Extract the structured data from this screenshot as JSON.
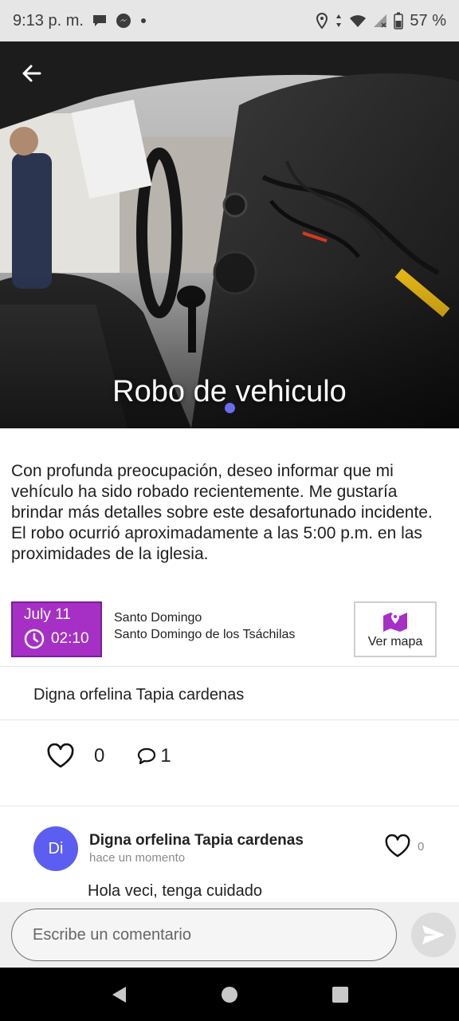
{
  "status_bar": {
    "time": "9:13 p. m.",
    "battery": "57 %"
  },
  "post": {
    "title": "Robo de vehiculo",
    "description": "Con profunda preocupación, deseo informar que mi vehículo ha sido robado recientemente. Me gustaría brindar más detalles sobre este desafortunado incidente. El robo ocurrió aproximadamente a las 5:00 p.m. en las proximidades de la iglesia.",
    "date": "July 11",
    "time": "02:10",
    "location_city": "Santo Domingo",
    "location_province": "Santo Domingo de los Tsáchilas",
    "map_button_label": "Ver mapa",
    "author": "Digna orfelina Tapia cardenas",
    "likes": "0",
    "comments": "1"
  },
  "comments": [
    {
      "initials": "Di",
      "author": "Digna orfelina Tapia cardenas",
      "time": "hace un momento",
      "likes": "0",
      "text": "Hola veci, tenga cuidado"
    }
  ],
  "comment_input": {
    "placeholder": "Escribe un comentario"
  },
  "colors": {
    "accent": "#a630c6",
    "avatar": "#5b5ef0",
    "page_indicator": "#6a6cf2"
  },
  "icons": {
    "back": "arrow-left-icon",
    "clock": "clock-icon",
    "map": "map-marker-icon",
    "like": "heart-icon",
    "comment": "comment-bubble-icon",
    "send": "send-icon"
  }
}
